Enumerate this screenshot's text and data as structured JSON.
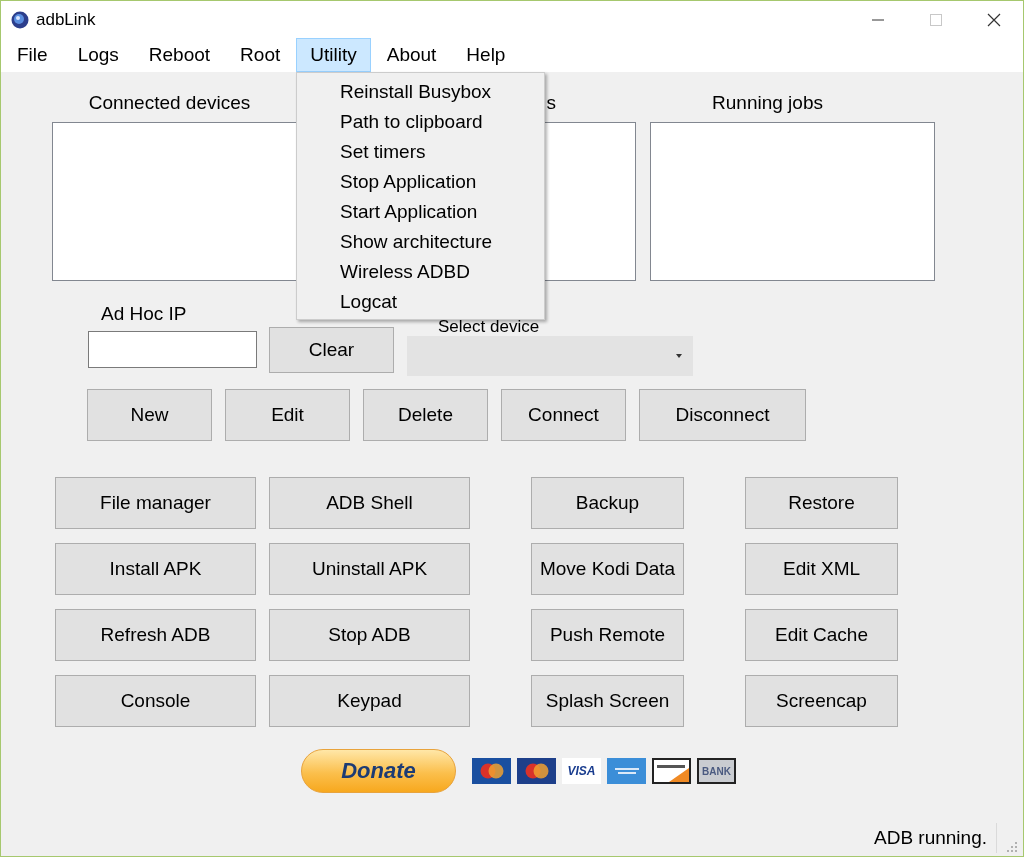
{
  "window": {
    "title": "adbLink"
  },
  "menu_bar": [
    {
      "label": "File",
      "selected": false
    },
    {
      "label": "Logs",
      "selected": false
    },
    {
      "label": "Reboot",
      "selected": false
    },
    {
      "label": "Root",
      "selected": false
    },
    {
      "label": "Utility",
      "selected": true
    },
    {
      "label": "About",
      "selected": false
    },
    {
      "label": "Help",
      "selected": false
    }
  ],
  "open_menu": {
    "items": [
      "Reinstall Busybox",
      "Path to clipboard",
      "Set timers",
      "Stop Application",
      "Start Application",
      "Show architecture",
      "Wireless ADBD",
      "Logcat"
    ]
  },
  "panels": [
    {
      "label": "Connected devices"
    },
    {
      "label": "s"
    },
    {
      "label": "Running jobs"
    }
  ],
  "ad_hoc": {
    "label": "Ad Hoc IP",
    "clear_button": "Clear"
  },
  "device_select": {
    "label": "Select device"
  },
  "device_buttons": [
    "New",
    "Edit",
    "Delete",
    "Connect",
    "Disconnect"
  ],
  "action_buttons": [
    [
      "File manager",
      "ADB Shell",
      "Backup",
      "Restore"
    ],
    [
      "Install APK",
      "Uninstall APK",
      "Move Kodi Data",
      "Edit XML"
    ],
    [
      "Refresh ADB",
      "Stop ADB",
      "Push Remote",
      "Edit Cache"
    ],
    [
      "Console",
      "Keypad",
      "Splash Screen",
      "Screencap"
    ]
  ],
  "donate": {
    "label": "Donate"
  },
  "payment_cards": [
    {
      "kind": "circles",
      "color": "#1a4fa0"
    },
    {
      "kind": "circles",
      "color": "#1d3f8a"
    },
    {
      "kind": "word",
      "label": "VISA",
      "color": "#ffffff"
    },
    {
      "kind": "plain",
      "color": "#3b8ed8"
    },
    {
      "kind": "stripe",
      "color": "#ffffff"
    },
    {
      "kind": "word",
      "label": "BANK",
      "color": "#c9ccd1"
    }
  ],
  "status_bar": {
    "text": "ADB running."
  }
}
